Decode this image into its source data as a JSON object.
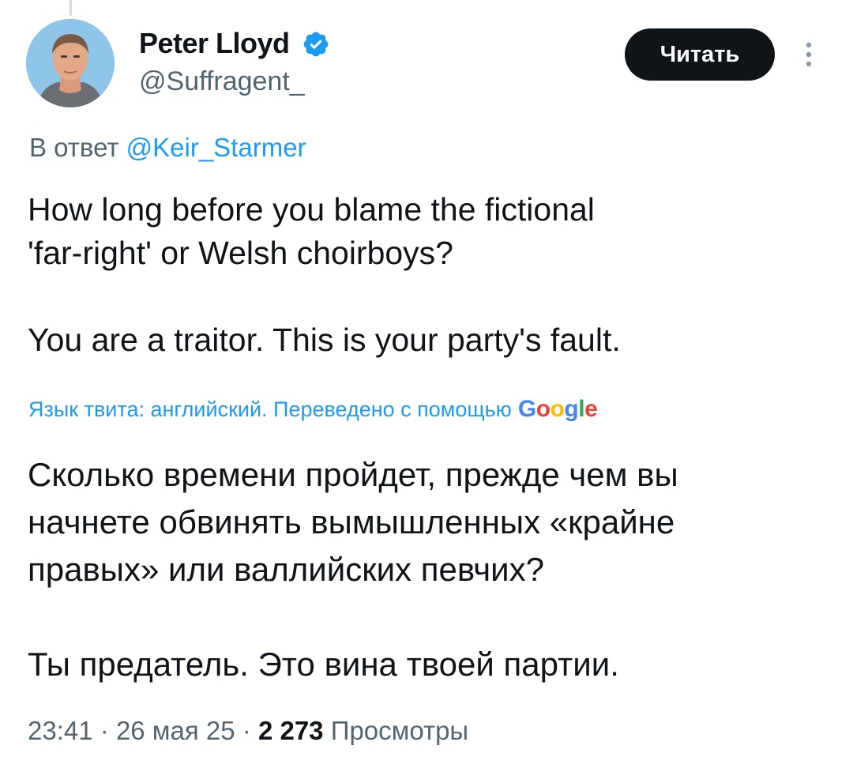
{
  "tweet": {
    "author": {
      "display_name": "Peter Lloyd",
      "handle": "@Suffragent_",
      "verified": true,
      "avatar_icon": "profile-photo"
    },
    "follow_label": "Читать",
    "more_icon": "more-vertical-icon",
    "reply_prefix": "В ответ",
    "reply_mention": "@Keir_Starmer",
    "text": {
      "paragraph1_line1": "How long before you blame the fictional",
      "paragraph1_line2": "'far-right' or Welsh choirboys?",
      "paragraph2": "You are a traitor. This is your party's fault."
    },
    "translation_label": "Язык твита: английский. Переведено с помощью",
    "translation_provider": "Google",
    "translated_text": {
      "line1": "Сколько времени пройдет, прежде чем вы",
      "line2": "начнете обвинять вымышленных «крайне",
      "line3": "правых» или валлийских певчих?",
      "paragraph2": "Ты предатель. Это вина твоей партии."
    },
    "meta": {
      "time": "23:41",
      "separator": "·",
      "date": "26 мая 25",
      "views_count": "2 273",
      "views_label": "Просмотры"
    },
    "colors": {
      "accent": "#1d9bf0",
      "secondary_text": "#536471",
      "primary_text": "#0f1419",
      "button_bg": "#0f1419"
    }
  }
}
